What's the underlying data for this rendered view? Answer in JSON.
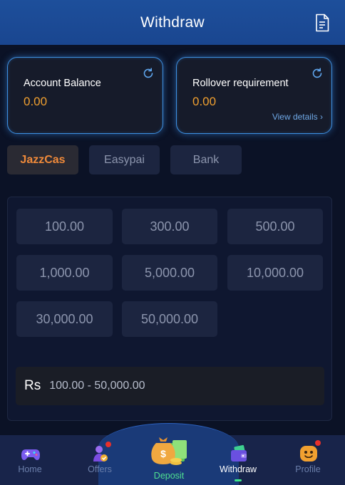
{
  "header": {
    "title": "Withdraw",
    "record_icon": "document-icon"
  },
  "balances": {
    "account": {
      "label": "Account Balance",
      "value": "0.00"
    },
    "rollover": {
      "label": "Rollover requirement",
      "value": "0.00",
      "link": "View details",
      "link_icon": "chevron-right-icon"
    }
  },
  "methods": [
    {
      "label": "JazzCas",
      "active": true
    },
    {
      "label": "Easypai",
      "active": false
    },
    {
      "label": "Bank",
      "active": false
    }
  ],
  "amounts": [
    "100.00",
    "300.00",
    "500.00",
    "1,000.00",
    "5,000.00",
    "10,000.00",
    "30,000.00",
    "50,000.00"
  ],
  "amount_input": {
    "currency": "Rs",
    "placeholder": "100.00 - 50,000.00"
  },
  "nav": [
    {
      "label": "Home",
      "icon": "gamepad-icon"
    },
    {
      "label": "Offers",
      "icon": "gift-icon"
    },
    {
      "label": "Deposit",
      "icon": "money-bag-icon"
    },
    {
      "label": "Withdraw",
      "icon": "wallet-icon",
      "active": true
    },
    {
      "label": "Profile",
      "icon": "smiley-icon"
    }
  ],
  "colors": {
    "accent": "#f0a030",
    "active_tab": "#f08a3a",
    "header": "#1d4f9b",
    "deposit": "#4fe090",
    "notification": "#e8302a"
  }
}
